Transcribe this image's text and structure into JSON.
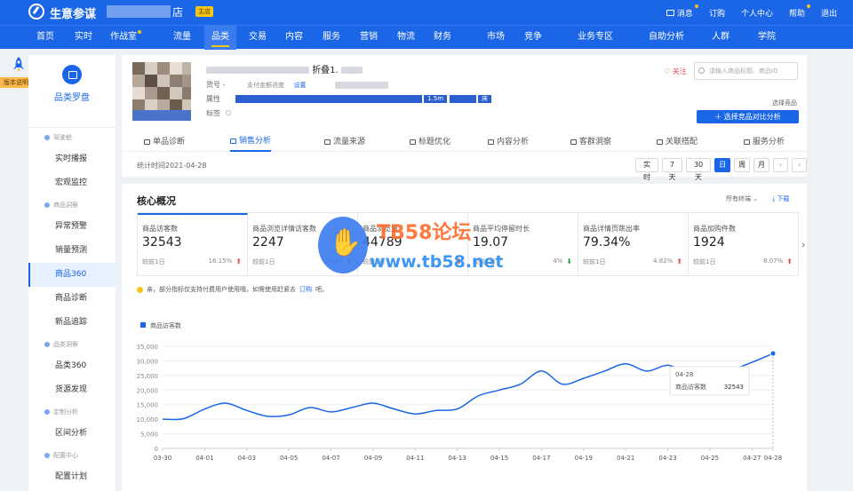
{
  "topbar": {
    "brand": "生意参谋",
    "shop_name_tail": "店",
    "shop_badge": "主店",
    "right_items": [
      {
        "label": "消息",
        "dot": true
      },
      {
        "label": "订购",
        "dot": false
      },
      {
        "label": "个人中心",
        "dot": false
      },
      {
        "label": "帮助",
        "dot": true
      },
      {
        "label": "退出",
        "dot": false
      }
    ]
  },
  "nav": {
    "items": [
      "首页",
      "实时",
      "作战室",
      "流量",
      "品类",
      "交易",
      "内容",
      "服务",
      "营销",
      "物流",
      "财务",
      "市场",
      "竞争",
      "业务专区",
      "自助分析",
      "人群",
      "学院"
    ],
    "active": "品类"
  },
  "version_tag": "版本说明",
  "sidebar": {
    "title": "品类罗盘",
    "sections": [
      {
        "group": "驾驶舱",
        "items": [
          "实时播报",
          "宏观监控"
        ]
      },
      {
        "group": "商品洞察",
        "items": [
          "异常预警",
          "销量预测",
          "商品360",
          "商品诊断",
          "新品追踪"
        ]
      },
      {
        "group": "品类洞察",
        "items": [
          "品类360",
          "货源发现"
        ]
      },
      {
        "group": "定制分析",
        "items": [
          "区间分析"
        ]
      },
      {
        "group": "配置中心",
        "items": [
          "配置计划"
        ]
      }
    ],
    "active_item": "商品360"
  },
  "product": {
    "title_tail": "折叠1.",
    "labels": {
      "id": "货号 -",
      "attr": "属性",
      "tag": "标签"
    },
    "id_extra": [
      "支付金额进度",
      "设置"
    ],
    "attr_tag": "1.5m",
    "attr_tail": "床",
    "follow": "关注",
    "search_placeholder": "请输入商品标题、商品ID",
    "compare_label": "选择竞品",
    "compare_button": "＋ 选择竞品对比分析"
  },
  "tabs": [
    "单品诊断",
    "销售分析",
    "流量来源",
    "标题优化",
    "内容分析",
    "客群洞察",
    "关联搭配",
    "服务分析"
  ],
  "active_tab": "销售分析",
  "stat_time": "统计时间2021-04-28",
  "date_buttons": [
    "实时",
    "7天",
    "30天",
    "日",
    "周",
    "月"
  ],
  "active_date": "日",
  "core": {
    "title": "核心概况",
    "terminal": "所有终端",
    "download": "下载",
    "metrics": [
      {
        "label": "商品访客数",
        "value": "32543",
        "compare": "较前1日",
        "pct": "16.15%",
        "dir": "up"
      },
      {
        "label": "商品浏览详情访客数",
        "value": "2247",
        "compare": "较前1日",
        "pct": "24.67",
        "dir": "up"
      },
      {
        "label": "商品浏览量",
        "value": "44789",
        "compare": "较前1日",
        "pct": "",
        "dir": "up"
      },
      {
        "label": "商品平均停留时长",
        "value": "19.07",
        "compare": "较前1日",
        "pct": "4%",
        "dir": "down"
      },
      {
        "label": "商品详情页跳出率",
        "value": "79.34%",
        "compare": "较前1日",
        "pct": "4.82%",
        "dir": "up"
      },
      {
        "label": "商品加购件数",
        "value": "1924",
        "compare": "较前1日",
        "pct": "8.07%",
        "dir": "up"
      }
    ],
    "notice_prefix": "亲，部分指标仅支持付费用户使用哦，如需使用赶紧去",
    "notice_link": "订购",
    "notice_suffix": "吧。"
  },
  "watermark": {
    "title": "TB58论坛",
    "url": "www.tb58.net"
  },
  "chart_data": {
    "type": "line",
    "legend": "商品访客数",
    "legend_position": "top-left",
    "x": [
      "03-30",
      "03-31",
      "04-01",
      "04-02",
      "04-03",
      "04-04",
      "04-05",
      "04-06",
      "04-07",
      "04-08",
      "04-09",
      "04-10",
      "04-11",
      "04-12",
      "04-13",
      "04-14",
      "04-15",
      "04-16",
      "04-17",
      "04-18",
      "04-19",
      "04-20",
      "04-21",
      "04-22",
      "04-23",
      "04-24",
      "04-25",
      "04-26",
      "04-27",
      "04-28"
    ],
    "xticks": [
      "03-30",
      "04-01",
      "04-03",
      "04-05",
      "04-07",
      "04-09",
      "04-11",
      "04-13",
      "04-15",
      "04-17",
      "04-19",
      "04-21",
      "04-23",
      "04-25",
      "04-27",
      "04-28"
    ],
    "series": [
      {
        "name": "商品访客数",
        "color": "#1a66e6",
        "values": [
          10000,
          10200,
          13500,
          15500,
          13000,
          11000,
          11500,
          14000,
          12500,
          14000,
          15500,
          13500,
          11800,
          13000,
          13500,
          18000,
          20000,
          22000,
          26500,
          22000,
          24000,
          26500,
          29000,
          26500,
          28500,
          26000,
          26500,
          27000,
          29500,
          32543
        ]
      }
    ],
    "ylim": [
      0,
      35000
    ],
    "yticks": [
      0,
      5000,
      10000,
      15000,
      20000,
      25000,
      30000,
      35000
    ],
    "ytick_labels": [
      "0",
      "5,000",
      "10,000",
      "15,000",
      "20,000",
      "25,000",
      "30,000",
      "35,000"
    ],
    "grid": true,
    "tooltip": {
      "date": "04-28",
      "label": "商品访客数",
      "value": "32543"
    }
  }
}
